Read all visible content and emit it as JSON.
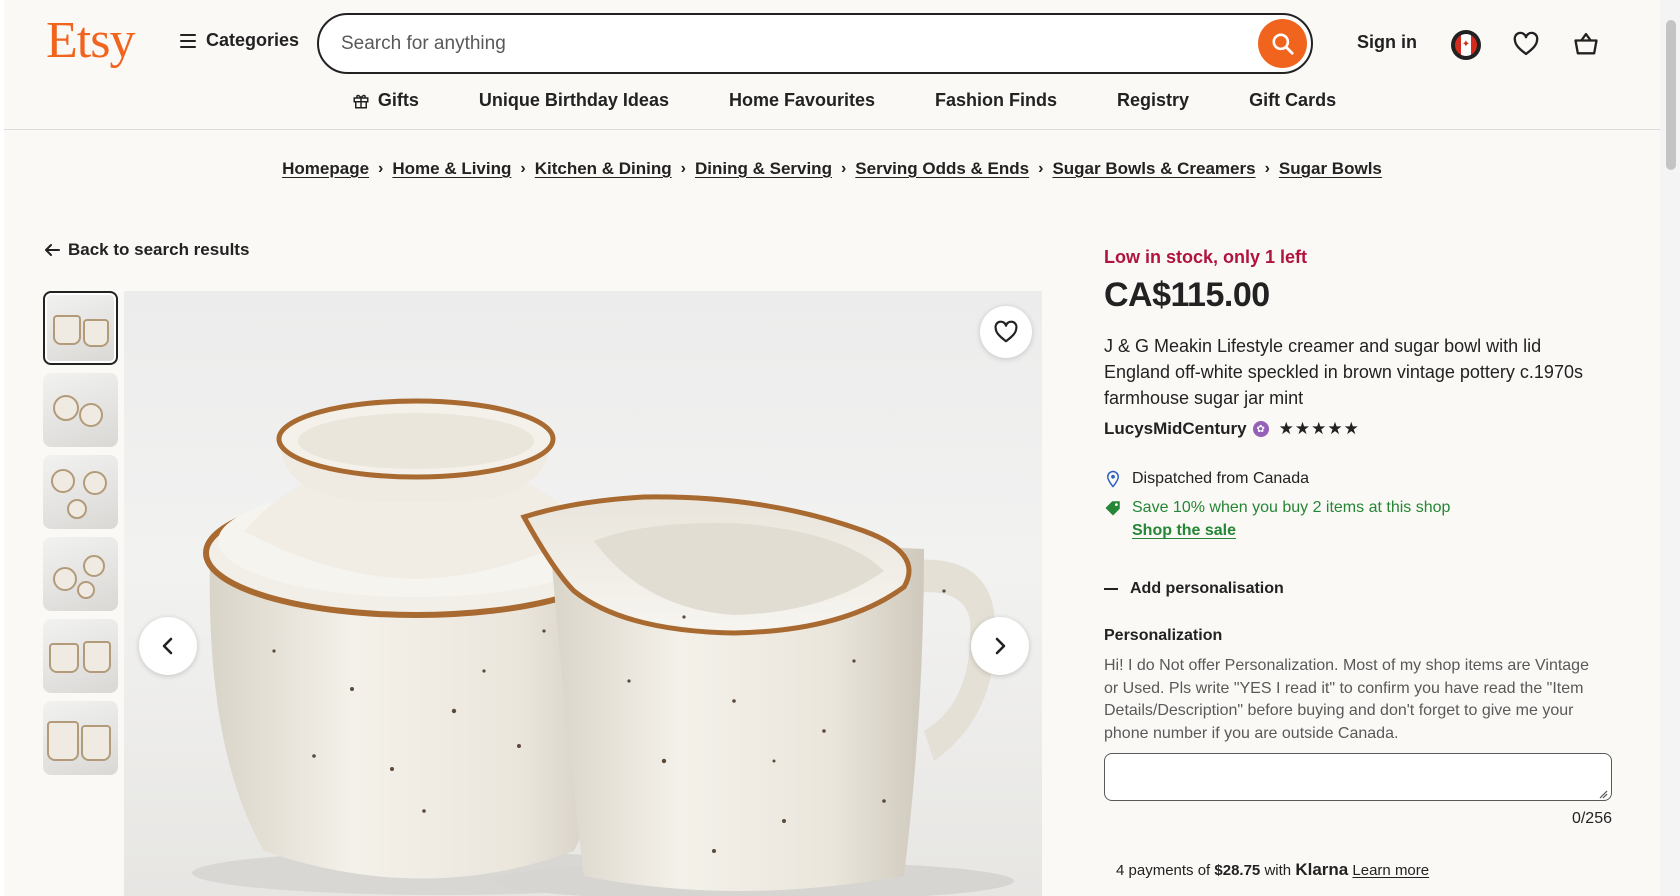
{
  "header": {
    "logo": "Etsy",
    "categories_label": "Categories",
    "search_placeholder": "Search for anything",
    "signin_label": "Sign in"
  },
  "nav": {
    "items": [
      "Gifts",
      "Unique Birthday Ideas",
      "Home Favourites",
      "Fashion Finds",
      "Registry",
      "Gift Cards"
    ]
  },
  "breadcrumb": [
    "Homepage",
    "Home & Living",
    "Kitchen & Dining",
    "Dining & Serving",
    "Serving Odds & Ends",
    "Sugar Bowls & Creamers",
    "Sugar Bowls"
  ],
  "back_label": "Back to search results",
  "thumbnails_count": 6,
  "product": {
    "stock_notice": "Low in stock, only 1 left",
    "price": "CA$115.00",
    "title": "J & G Meakin Lifestyle creamer and sugar bowl with lid England off-white speckled in brown vintage pottery c.1970s farmhouse sugar jar mint",
    "shop_name": "LucysMidCentury",
    "rating_stars": 5,
    "stars_text": "★★★★★",
    "dispatch": "Dispatched from Canada",
    "sale_text": "Save 10% when you buy 2 items at this shop",
    "sale_link": "Shop the sale",
    "add_personalisation": "Add personalisation",
    "personalization_label": "Personalization",
    "personalization_text": "Hi! I do Not offer Personalization. Most of my shop items are Vintage or Used. Pls write \"YES I read it\" to confirm you have read the \"Item Details/Description\" before buying and don't forget to give me your phone number if you are outside Canada.",
    "personalization_value": "",
    "char_counter": "0/256"
  },
  "klarna": {
    "prefix": "4 payments of",
    "amount": "$28.75",
    "with": "with",
    "brand": "Klarna",
    "learn_more": "Learn more"
  },
  "colors": {
    "brand": "#f1641e",
    "stock_red": "#b1133d",
    "sale_green": "#258635",
    "background": "#faf9f6"
  },
  "icons": {
    "search": "search-icon",
    "flag": "canada-flag-icon",
    "favorites": "heart-icon",
    "cart": "basket-icon",
    "gift": "gift-icon",
    "back": "arrow-left-icon",
    "prev": "chevron-left-icon",
    "next": "chevron-right-icon",
    "location": "location-pin-icon",
    "tag": "tag-icon",
    "star_seller": "star-seller-badge-icon"
  }
}
